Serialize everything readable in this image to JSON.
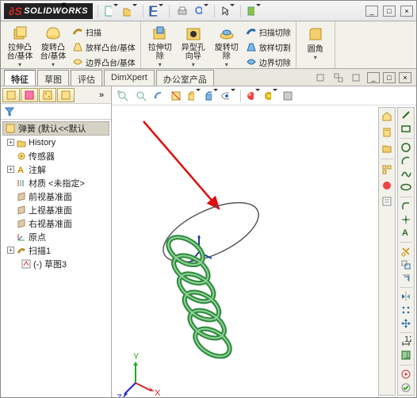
{
  "app_name": "SOLIDWORKS",
  "titlebar": {
    "win_minimize": "_",
    "win_maximize": "□",
    "win_close": "×"
  },
  "ribbon": {
    "extrude_boss": "拉伸凸\n台/基体",
    "revolve_boss": "旋转凸\n台/基体",
    "sweep": "扫描",
    "loft": "放样凸台/基体",
    "boundary": "边界凸台/基体",
    "extrude_cut": "拉伸切\n除",
    "hole_wizard": "异型孔\n向导",
    "revolve_cut": "旋转切\n除",
    "sweep_cut": "扫描切除",
    "loft_cut": "放样切割",
    "boundary_cut": "边界切除",
    "fillet": "圆角"
  },
  "tabs": {
    "feature": "特征",
    "sketch": "草图",
    "evaluate": "评估",
    "dimxpert": "DimXpert",
    "office": "办公室产品"
  },
  "tree": {
    "root": "弹簧  (默认<<默认",
    "history": "History",
    "sensors": "传感器",
    "annotations": "注解",
    "material": "材质 <未指定>",
    "front": "前视基准面",
    "top": "上视基准面",
    "right": "右视基准面",
    "origin": "原点",
    "sweep1": "扫描1",
    "sketch3": "(-) 草图3"
  }
}
